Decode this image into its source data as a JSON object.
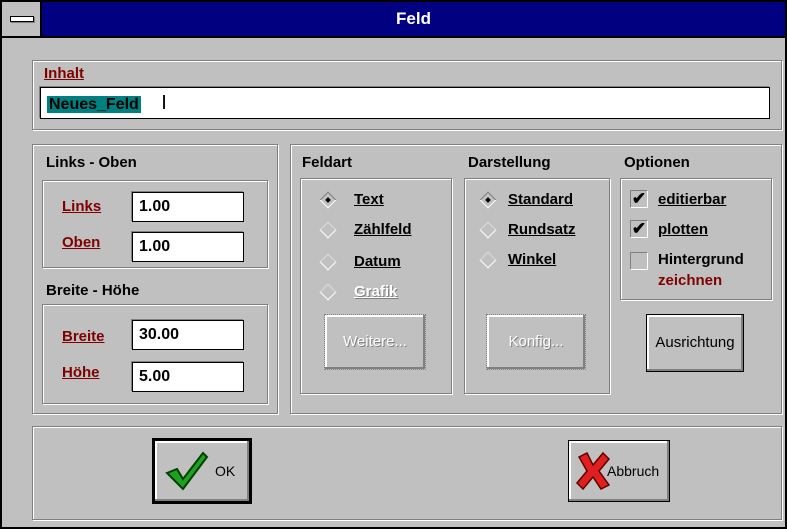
{
  "window": {
    "title": "Feld"
  },
  "inhalt": {
    "label": "Inhalt",
    "value": "Neues_Feld"
  },
  "links_oben": {
    "title": "Links - Oben",
    "links_label": "Links",
    "links_value": "1.00",
    "oben_label": "Oben",
    "oben_value": "1.00"
  },
  "breite_hoehe": {
    "title": "Breite - Höhe",
    "breite_label": "Breite",
    "breite_value": "30.00",
    "hoehe_label": "Höhe",
    "hoehe_value": "5.00"
  },
  "feldart": {
    "title": "Feldart",
    "options": [
      "Text",
      "Zählfeld",
      "Datum",
      "Grafik"
    ],
    "selected": "Text",
    "button": "Weitere..."
  },
  "darstellung": {
    "title": "Darstellung",
    "options": [
      "Standard",
      "Rundsatz",
      "Winkel"
    ],
    "selected": "Standard",
    "button": "Konfig..."
  },
  "optionen": {
    "title": "Optionen",
    "editierbar": {
      "label": "editierbar",
      "checked": true
    },
    "plotten": {
      "label": "plotten",
      "checked": true
    },
    "hintergrund": {
      "label1": "Hintergrund",
      "label2": "zeichnen",
      "checked": false
    },
    "button": "Ausrichtung"
  },
  "buttons": {
    "ok": "OK",
    "cancel": "Abbruch"
  },
  "colors": {
    "title_bar": "#000080",
    "face": "#c0c0c0",
    "label_red": "#800000",
    "selection": "#008080"
  }
}
